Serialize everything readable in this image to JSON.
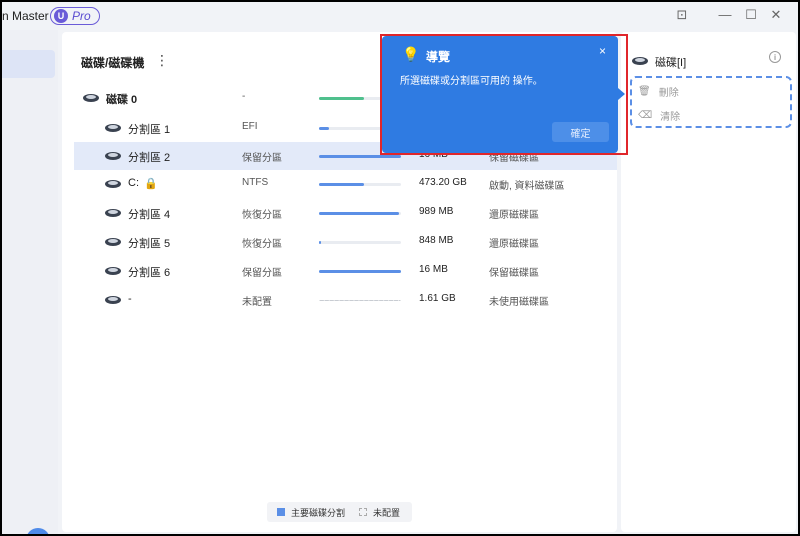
{
  "app": {
    "title": "n Master",
    "badge_u": "U",
    "badge_pro": "Pro"
  },
  "header": {
    "title": "磁碟/磁碟機",
    "more": "⋮"
  },
  "disks": [
    {
      "name": "磁碟 0",
      "fs": "-",
      "size": "",
      "type": "",
      "usage": 0.55,
      "bar": "green"
    },
    {
      "name": "分割區 1",
      "fs": "EFI",
      "size": "",
      "type": "",
      "usage": 0.12,
      "bar": "blue"
    },
    {
      "name": "分割區 2",
      "fs": "保留分區",
      "size": "16 MB",
      "type": "保留磁碟區",
      "usage": 1.0,
      "bar": "blue",
      "selected": true
    },
    {
      "name": "C:",
      "fs": "NTFS",
      "size": "473.20 GB",
      "type": "啟動, 資料磁碟區",
      "usage": 0.55,
      "bar": "blue",
      "locked": true
    },
    {
      "name": "分割區 4",
      "fs": "恢復分區",
      "size": "989 MB",
      "type": "還原磁碟區",
      "usage": 0.98,
      "bar": "blue"
    },
    {
      "name": "分割區 5",
      "fs": "恢復分區",
      "size": "848 MB",
      "type": "還原磁碟區",
      "usage": 0.02,
      "bar": "blue"
    },
    {
      "name": "分割區 6",
      "fs": "保留分區",
      "size": "16 MB",
      "type": "保留磁碟區",
      "usage": 1.0,
      "bar": "blue"
    },
    {
      "name": "-",
      "fs": "未配置",
      "size": "1.61 GB",
      "type": "未使用磁碟區",
      "usage": 0,
      "bar": "dash"
    }
  ],
  "legend": {
    "primary": "主要磁碟分割",
    "unallocated": "未配置"
  },
  "right_panel": {
    "title": "磁碟[I]",
    "info": "i",
    "delete": "刪除",
    "wipe": "清除"
  },
  "tour": {
    "title": "導覽",
    "text": "所選磁碟或分割區可用的 操作。",
    "close": "×",
    "ok": "確定"
  },
  "colors": {
    "accent": "#2f7be2",
    "highlight_frame": "#e0262b",
    "selected_row": "#e3eaf9"
  }
}
